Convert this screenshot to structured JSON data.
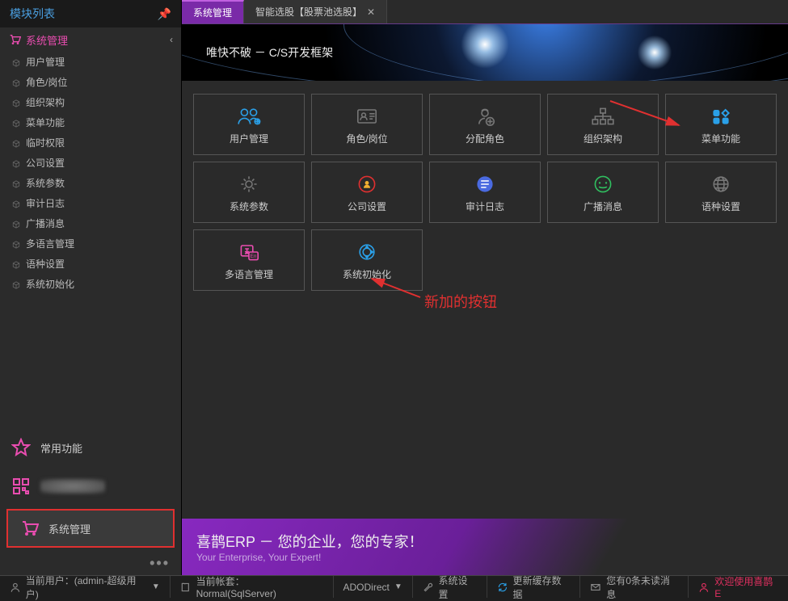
{
  "sidebar": {
    "header": "模块列表",
    "sections": {
      "sysmgmt": {
        "title": "系统管理",
        "items": [
          "用户管理",
          "角色/岗位",
          "组织架构",
          "菜单功能",
          "临时权限",
          "公司设置",
          "系统参数",
          "审计日志",
          "广播消息",
          "多语言管理",
          "语种设置",
          "系统初始化"
        ]
      }
    },
    "bottom": {
      "fav": "常用功能",
      "sysmgmt": "系统管理"
    }
  },
  "tabs": [
    {
      "label": "系统管理",
      "active": true,
      "closable": false
    },
    {
      "label": "智能选股【股票池选股】",
      "active": false,
      "closable": true
    }
  ],
  "banner": {
    "title": "唯快不破 － C/S开发框架"
  },
  "tiles": [
    {
      "label": "用户管理",
      "icon": "users",
      "color": "#2aa0e8"
    },
    {
      "label": "角色/岗位",
      "icon": "idcard",
      "color": "#777"
    },
    {
      "label": "分配角色",
      "icon": "assign",
      "color": "#777"
    },
    {
      "label": "组织架构",
      "icon": "org",
      "color": "#777"
    },
    {
      "label": "菜单功能",
      "icon": "menu",
      "color": "#2aa0e8"
    },
    {
      "label": "系统参数",
      "icon": "gear",
      "color": "#777"
    },
    {
      "label": "公司设置",
      "icon": "company",
      "color": "#f0b030"
    },
    {
      "label": "审计日志",
      "icon": "log",
      "color": "#4a6ae0"
    },
    {
      "label": "广播消息",
      "icon": "broadcast",
      "color": "#30c060"
    },
    {
      "label": "语种设置",
      "icon": "globe",
      "color": "#777"
    },
    {
      "label": "多语言管理",
      "icon": "lang",
      "color": "#e94db0"
    },
    {
      "label": "系统初始化",
      "icon": "init",
      "color": "#2aa0e8"
    }
  ],
  "annotation": "新加的按钮",
  "footerBanner": {
    "line1": "喜鹊ERP － 您的企业，您的专家！",
    "line2": "Your Enterprise, Your Expert!"
  },
  "status": {
    "user": "当前用户：(admin-超级用户)",
    "ledger": "当前帐套：Normal(SqlServer)",
    "conn": "ADODirect",
    "settings": "系统设置",
    "refresh": "更新缓存数据",
    "unread": "您有0条未读消息",
    "welcome": "欢迎使用喜鹊E"
  }
}
